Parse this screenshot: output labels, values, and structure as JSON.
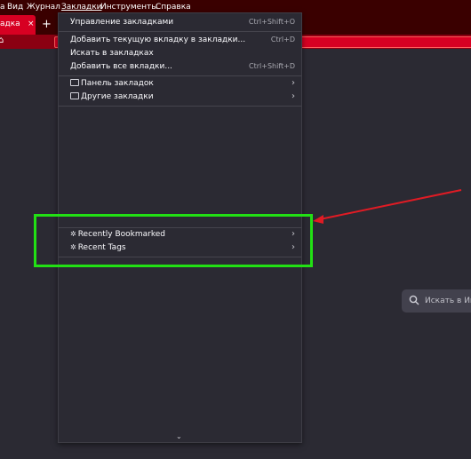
{
  "menubar": {
    "items": [
      "а",
      "Вид",
      "Журнал",
      "Закладки",
      "Инструменты",
      "Справка"
    ]
  },
  "tab": {
    "title": "адка",
    "close": "×"
  },
  "newtab": "+",
  "bookmarks_menu": {
    "items": [
      {
        "label": "Управление закладками",
        "shortcut": "Ctrl+Shift+O"
      },
      {
        "label": "Добавить текущую вкладку в закладки...",
        "shortcut": "Ctrl+D"
      },
      {
        "label": "Искать в закладках",
        "shortcut": ""
      },
      {
        "label": "Добавить все вкладки...",
        "shortcut": "Ctrl+Shift+D"
      }
    ],
    "folders": [
      {
        "label": "Панель закладок"
      },
      {
        "label": "Другие закладки"
      }
    ],
    "smart": [
      {
        "label": "Recently Bookmarked"
      },
      {
        "label": "Recent Tags"
      }
    ]
  },
  "search": {
    "placeholder": "Искать в Ин"
  },
  "colors": {
    "highlight": "#22e014",
    "arrow": "#e01b24",
    "accent": "#d70022"
  }
}
